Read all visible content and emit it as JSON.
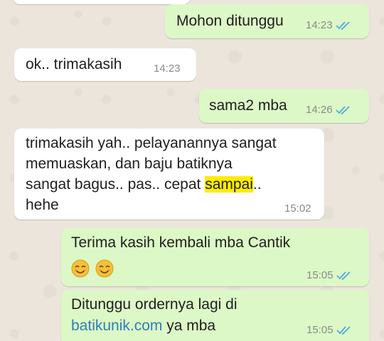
{
  "messages": [
    {
      "id": "m1",
      "direction": "out",
      "text": "Mohon ditunggu",
      "time": "14:23",
      "status": "read"
    },
    {
      "id": "m2",
      "direction": "in",
      "text": "ok.. trimakasih",
      "time": "14:23"
    },
    {
      "id": "m3",
      "direction": "out",
      "text": "sama2 mba",
      "time": "14:26",
      "status": "read"
    },
    {
      "id": "m4",
      "direction": "in",
      "lines": [
        "trimakasih yah.. pelayanannya sangat",
        "memuaskan, dan baju batiknya",
        "sangat bagus.. pas.. cepat ",
        "hehe"
      ],
      "highlight_word": "sampai",
      "line3_suffix": "..",
      "time": "15:02"
    },
    {
      "id": "m5",
      "direction": "out",
      "text": "Terima kasih kembali mba Cantik",
      "emoji": "smiling-face-with-smiling-eyes",
      "time": "15:05",
      "status": "read"
    },
    {
      "id": "m6",
      "direction": "out",
      "line1": "Ditunggu ordernya lagi di",
      "link": "batikunik.com",
      "line2_suffix": " ya mba",
      "time": "15:05",
      "status": "read"
    }
  ],
  "colors": {
    "outgoing_bubble": "#dcf8c6",
    "incoming_bubble": "#ffffff",
    "background": "#ece5dc",
    "read_tick": "#4fa8e0",
    "link": "#2f7fb5",
    "highlight": "#ffec00"
  }
}
